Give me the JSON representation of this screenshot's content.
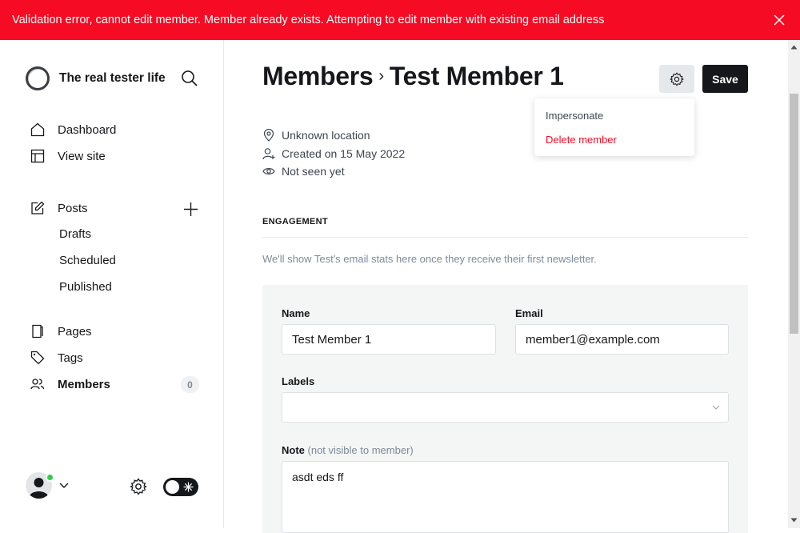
{
  "banner": {
    "message": "Validation error, cannot edit member. Member already exists. Attempting to edit member with existing email address",
    "close_icon": "close-icon",
    "color": "#f50b23"
  },
  "sidebar": {
    "site_title": "The real tester life",
    "nav": {
      "dashboard": "Dashboard",
      "view_site": "View site",
      "posts": "Posts",
      "drafts": "Drafts",
      "scheduled": "Scheduled",
      "published": "Published",
      "pages": "Pages",
      "tags": "Tags",
      "members": "Members"
    },
    "members_count": "0"
  },
  "header": {
    "breadcrumb_parent": "Members",
    "breadcrumb_sep": "›",
    "member_name": "Test Member 1",
    "save_label": "Save"
  },
  "dropdown": {
    "impersonate": "Impersonate",
    "delete": "Delete member",
    "delete_color": "#f50b23"
  },
  "meta": {
    "location": "Unknown location",
    "created": "Created on 15 May 2022",
    "seen": "Not seen yet"
  },
  "engagement": {
    "heading": "ENGAGEMENT",
    "text": "We'll show Test's email stats here once they receive their first newsletter."
  },
  "form": {
    "name_label": "Name",
    "name_value": "Test Member 1",
    "email_label": "Email",
    "email_value": "member1@example.com",
    "labels_label": "Labels",
    "labels_value": "",
    "note_label": "Note",
    "note_hint": "(not visible to member)",
    "note_value": "asdt eds ff"
  }
}
